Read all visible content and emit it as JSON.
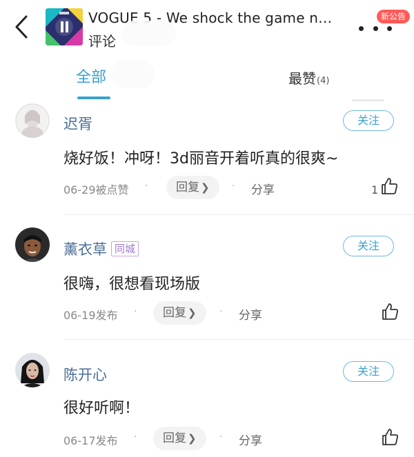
{
  "header": {
    "title": "VOGUE 5 - We shock the game now…",
    "subtitle": "评论",
    "notice_badge": "新公告"
  },
  "tabs": {
    "all": "全部",
    "top_label": "最赞",
    "top_count": "(4)"
  },
  "comments": [
    {
      "username": "迟胥",
      "tag": "",
      "follow_label": "关注",
      "text": "烧好饭！冲呀！3d丽音开着听真的很爽~",
      "meta": "06-29被点赞",
      "reply_label": "回复",
      "share_label": "分享",
      "like_count": "1"
    },
    {
      "username": "薰衣草",
      "tag": "同城",
      "follow_label": "关注",
      "text": "很嗨，很想看现场版",
      "meta": "06-19发布",
      "reply_label": "回复",
      "share_label": "分享",
      "like_count": ""
    },
    {
      "username": "陈开心",
      "tag": "",
      "follow_label": "关注",
      "text": "很好听啊！",
      "meta": "06-17发布",
      "reply_label": "回复",
      "share_label": "分享",
      "like_count": ""
    }
  ],
  "colors": {
    "accent": "#3aa1cf",
    "username": "#4a6d98",
    "badge": "#ff5a57",
    "tag": "#a17ad0"
  }
}
